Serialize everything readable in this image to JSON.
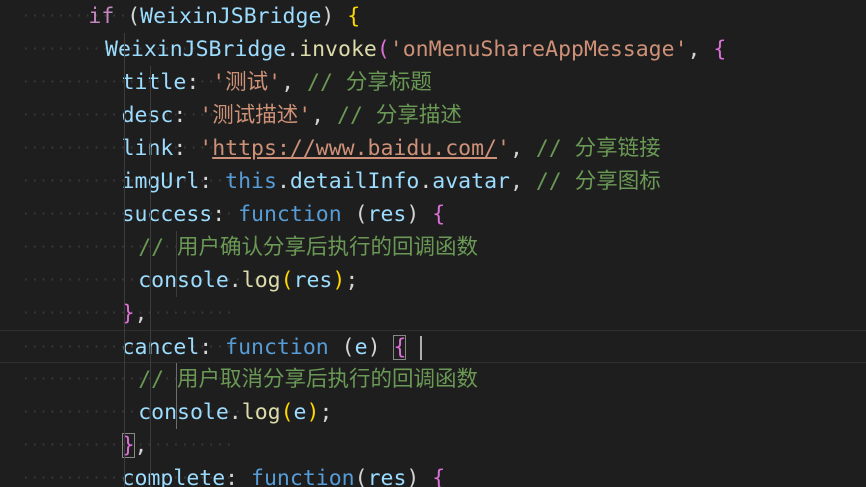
{
  "lines": [
    {
      "indent": "        ",
      "tokens": [
        {
          "t": "if",
          "c": "kw"
        },
        {
          "t": " (",
          "c": "punct"
        },
        {
          "t": "WeixinJSBridge",
          "c": "key"
        },
        {
          "t": ") ",
          "c": "punct"
        },
        {
          "t": "{",
          "c": "brace2"
        }
      ]
    },
    {
      "indent": "          ",
      "tokens": [
        {
          "t": "WeixinJSBridge",
          "c": "key"
        },
        {
          "t": ".",
          "c": "punct"
        },
        {
          "t": "invoke",
          "c": "fn"
        },
        {
          "t": "(",
          "c": "brace1"
        },
        {
          "t": "'onMenuShareAppMessage'",
          "c": "str"
        },
        {
          "t": ", ",
          "c": "punct"
        },
        {
          "t": "{",
          "c": "brace1"
        }
      ]
    },
    {
      "indent": "            ",
      "tokens": [
        {
          "t": "title",
          "c": "key"
        },
        {
          "t": ": ",
          "c": "punct"
        },
        {
          "t": "'测试'",
          "c": "str"
        },
        {
          "t": ", ",
          "c": "punct"
        },
        {
          "t": "// 分享标题",
          "c": "com"
        }
      ]
    },
    {
      "indent": "            ",
      "tokens": [
        {
          "t": "desc",
          "c": "key"
        },
        {
          "t": ": ",
          "c": "punct"
        },
        {
          "t": "'测试描述'",
          "c": "str"
        },
        {
          "t": ", ",
          "c": "punct"
        },
        {
          "t": "// 分享描述",
          "c": "com"
        }
      ]
    },
    {
      "indent": "            ",
      "tokens": [
        {
          "t": "link",
          "c": "key"
        },
        {
          "t": ": ",
          "c": "punct"
        },
        {
          "t": "'",
          "c": "str"
        },
        {
          "t": "https://www.baidu.com/",
          "c": "str link"
        },
        {
          "t": "'",
          "c": "str"
        },
        {
          "t": ", ",
          "c": "punct"
        },
        {
          "t": "// 分享链接",
          "c": "com"
        }
      ]
    },
    {
      "indent": "            ",
      "tokens": [
        {
          "t": "imgUrl",
          "c": "key"
        },
        {
          "t": ": ",
          "c": "punct"
        },
        {
          "t": "this",
          "c": "this"
        },
        {
          "t": ".",
          "c": "punct"
        },
        {
          "t": "detailInfo",
          "c": "key"
        },
        {
          "t": ".",
          "c": "punct"
        },
        {
          "t": "avatar",
          "c": "key"
        },
        {
          "t": ", ",
          "c": "punct"
        },
        {
          "t": "// 分享图标",
          "c": "com"
        }
      ]
    },
    {
      "indent": "            ",
      "tokens": [
        {
          "t": "success",
          "c": "key"
        },
        {
          "t": ": ",
          "c": "punct"
        },
        {
          "t": "function",
          "c": "this"
        },
        {
          "t": " (",
          "c": "punct"
        },
        {
          "t": "res",
          "c": "key"
        },
        {
          "t": ") ",
          "c": "punct"
        },
        {
          "t": "{",
          "c": "brace1"
        }
      ]
    },
    {
      "indent": "              ",
      "tokens": [
        {
          "t": "// 用户确认分享后执行的回调函数",
          "c": "com"
        }
      ]
    },
    {
      "indent": "              ",
      "tokens": [
        {
          "t": "console",
          "c": "key"
        },
        {
          "t": ".",
          "c": "punct"
        },
        {
          "t": "log",
          "c": "fn"
        },
        {
          "t": "(",
          "c": "brace2"
        },
        {
          "t": "res",
          "c": "key"
        },
        {
          "t": ")",
          "c": "brace2"
        },
        {
          "t": ";",
          "c": "punct"
        }
      ]
    },
    {
      "indent": "            ",
      "tokens": [
        {
          "t": "}",
          "c": "brace1"
        },
        {
          "t": ",",
          "c": "punct"
        }
      ]
    },
    {
      "indent": "            ",
      "active": true,
      "tokens": [
        {
          "t": "cancel",
          "c": "key"
        },
        {
          "t": ": ",
          "c": "punct"
        },
        {
          "t": "function",
          "c": "this"
        },
        {
          "t": " (",
          "c": "punct"
        },
        {
          "t": "e",
          "c": "key"
        },
        {
          "t": ") ",
          "c": "punct"
        },
        {
          "t": "{",
          "c": "brace1 match"
        }
      ]
    },
    {
      "indent": "              ",
      "tokens": [
        {
          "t": "// 用户取消分享后执行的回调函数",
          "c": "com"
        }
      ]
    },
    {
      "indent": "              ",
      "tokens": [
        {
          "t": "console",
          "c": "key"
        },
        {
          "t": ".",
          "c": "punct"
        },
        {
          "t": "log",
          "c": "fn"
        },
        {
          "t": "(",
          "c": "brace2"
        },
        {
          "t": "e",
          "c": "key"
        },
        {
          "t": ")",
          "c": "brace2"
        },
        {
          "t": ";",
          "c": "punct"
        }
      ]
    },
    {
      "indent": "            ",
      "tokens": [
        {
          "t": "}",
          "c": "brace1 match"
        },
        {
          "t": ",",
          "c": "punct"
        }
      ]
    },
    {
      "indent": "            ",
      "tokens": [
        {
          "t": "complete",
          "c": "key"
        },
        {
          "t": ": ",
          "c": "punct"
        },
        {
          "t": "function",
          "c": "this"
        },
        {
          "t": "(",
          "c": "punct"
        },
        {
          "t": "res",
          "c": "key"
        },
        {
          "t": ") ",
          "c": "punct"
        },
        {
          "t": "{",
          "c": "brace1"
        }
      ]
    }
  ],
  "colors": {
    "background": "#1e1e1e",
    "keyword": "#c586c0",
    "variable": "#9cdcfe",
    "function": "#dcdcaa",
    "string": "#ce9178",
    "comment": "#6a9955",
    "this_keyword": "#569cd6"
  }
}
